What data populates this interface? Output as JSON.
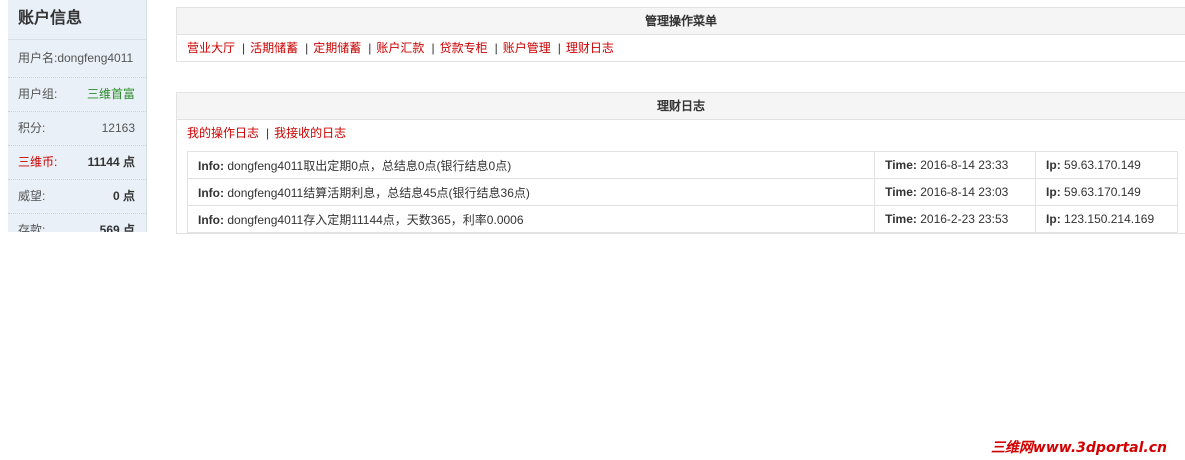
{
  "sidebar": {
    "title": "账户信息",
    "rows": [
      {
        "label": "用户名:dongfeng4011",
        "value": ""
      },
      {
        "label": "用户组:",
        "value": "三维首富"
      },
      {
        "label": "积分:",
        "value": "12163"
      },
      {
        "label": "三维币:",
        "value": "11144 点"
      },
      {
        "label": "威望:",
        "value": "0 点"
      },
      {
        "label": "存款:",
        "value": "569 点"
      }
    ]
  },
  "menu": {
    "title": "管理操作菜单",
    "links": [
      "营业大厅",
      "活期储蓄",
      "定期储蓄",
      "账户汇款",
      "贷款专柜",
      "账户管理",
      "理财日志"
    ]
  },
  "log": {
    "title": "理财日志",
    "links": [
      "我的操作日志",
      "我接收的日志"
    ],
    "info_label": "Info:",
    "time_label": "Time:",
    "ip_label": "Ip:",
    "rows": [
      {
        "info": "dongfeng4011取出定期0点，总结息0点(银行结息0点)",
        "time": "2016-8-14 23:33",
        "ip": "59.63.170.149"
      },
      {
        "info": "dongfeng4011结算活期利息，总结息45点(银行结息36点)",
        "time": "2016-8-14 23:03",
        "ip": "59.63.170.149"
      },
      {
        "info": "dongfeng4011存入定期11144点，天数365，利率0.0006",
        "time": "2016-2-23 23:53",
        "ip": "123.150.214.169"
      }
    ]
  },
  "watermark": "三维网www.3dportal.cn"
}
